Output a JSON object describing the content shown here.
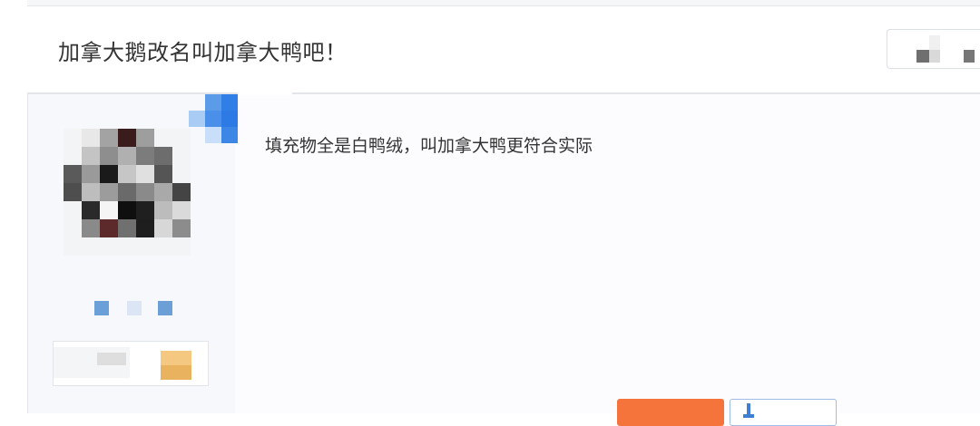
{
  "thread": {
    "title": "加拿大鹅改名叫加拿大鸭吧！"
  },
  "post": {
    "content": "填充物全是白鸭绒，叫加拿大鸭更符合实际"
  },
  "actions": {
    "orange_button_label": "",
    "share_button_label": ""
  },
  "colors": {
    "accent_orange": "#f4743b",
    "accent_blue": "#3f7fd3",
    "divider": "#e3e5e8"
  }
}
